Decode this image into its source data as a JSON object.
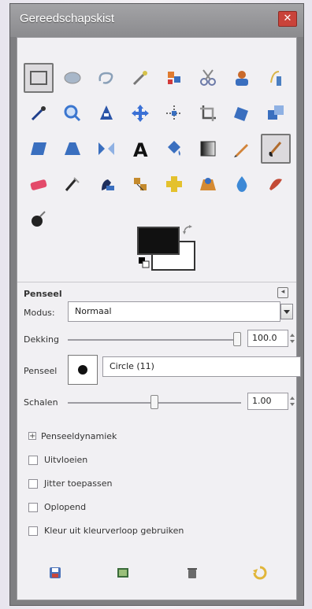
{
  "window": {
    "title": "Gereedschapskist",
    "close_glyph": "✕"
  },
  "tools": [
    {
      "name": "rect-select-icon",
      "kind": "rect",
      "color": "#5c5c5c",
      "active": true
    },
    {
      "name": "ellipse-select-icon",
      "kind": "ellipse",
      "color": "#8aa0b8"
    },
    {
      "name": "lasso-icon",
      "kind": "lasso",
      "color": "#8aa0b8"
    },
    {
      "name": "fuzzy-select-icon",
      "kind": "wand",
      "color": "#d6c24a"
    },
    {
      "name": "select-by-color-icon",
      "kind": "blocks",
      "color": "#e07b2f"
    },
    {
      "name": "scissors-icon",
      "kind": "scissors",
      "color": "#6c7aa8"
    },
    {
      "name": "foreground-select-icon",
      "kind": "person",
      "color": "#c96a2b"
    },
    {
      "name": "paths-icon",
      "kind": "pen",
      "color": "#4b7fc1"
    },
    {
      "name": "color-picker-icon",
      "kind": "picker",
      "color": "#1f3f8c"
    },
    {
      "name": "zoom-icon",
      "kind": "zoom",
      "color": "#3b76cf"
    },
    {
      "name": "measure-icon",
      "kind": "measure",
      "color": "#2b55a8"
    },
    {
      "name": "move-icon",
      "kind": "move",
      "color": "#3a70d5"
    },
    {
      "name": "align-icon",
      "kind": "align",
      "color": "#6a6a6a"
    },
    {
      "name": "crop-icon",
      "kind": "crop",
      "color": "#555"
    },
    {
      "name": "rotate-icon",
      "kind": "rotate",
      "color": "#3a6fbf"
    },
    {
      "name": "scale-icon",
      "kind": "scale",
      "color": "#3a6fbf"
    },
    {
      "name": "shear-icon",
      "kind": "shear",
      "color": "#3a6fbf"
    },
    {
      "name": "perspective-icon",
      "kind": "perspective",
      "color": "#3a6fbf"
    },
    {
      "name": "flip-icon",
      "kind": "flip",
      "color": "#3a6fbf"
    },
    {
      "name": "text-icon",
      "kind": "text",
      "color": "#111"
    },
    {
      "name": "bucket-fill-icon",
      "kind": "bucket",
      "color": "#3a6fbf"
    },
    {
      "name": "gradient-icon",
      "kind": "gradient",
      "color": "#333"
    },
    {
      "name": "pencil-icon",
      "kind": "pencil",
      "color": "#d2843a"
    },
    {
      "name": "paintbrush-icon",
      "kind": "brush",
      "color": "#b06b2d",
      "active": true
    },
    {
      "name": "eraser-icon",
      "kind": "eraser",
      "color": "#e34a6a"
    },
    {
      "name": "airbrush-icon",
      "kind": "airbrush",
      "color": "#2a2a2a"
    },
    {
      "name": "ink-icon",
      "kind": "ink",
      "color": "#1d2e5c"
    },
    {
      "name": "clone-icon",
      "kind": "clone",
      "color": "#c48a2d"
    },
    {
      "name": "heal-icon",
      "kind": "heal",
      "color": "#e4c12d"
    },
    {
      "name": "perspective-clone-icon",
      "kind": "persp-clone",
      "color": "#d58a32"
    },
    {
      "name": "blur-icon",
      "kind": "blur",
      "color": "#3d89d6"
    },
    {
      "name": "smudge-icon",
      "kind": "smudge",
      "color": "#c34a36"
    },
    {
      "name": "dodge-burn-icon",
      "kind": "dodge",
      "color": "#222"
    }
  ],
  "colors": {
    "foreground": "#111111",
    "background": "#ffffff"
  },
  "panel": {
    "title": "Penseel",
    "mode_label": "Modus:",
    "mode_value": "Normaal",
    "opacity_label": "Dekking",
    "opacity_value": "100.0",
    "opacity_level": 1.0,
    "brush_label": "Penseel",
    "brush_name": "Circle (11)",
    "scale_label": "Schalen",
    "scale_value": "1.00",
    "scale_level": 0.5,
    "dynamics_label": "Penseeldynamiek",
    "fade_label": "Uitvloeien",
    "jitter_label": "Jitter toepassen",
    "incremental_label": "Oplopend",
    "gradient_label": "Kleur uit kleurverloop gebruiken"
  },
  "bottom_icons": [
    {
      "name": "save-options-icon",
      "color": "#c9463b"
    },
    {
      "name": "restore-options-icon",
      "color": "#3a6b3a"
    },
    {
      "name": "delete-options-icon",
      "color": "#6a6a6a"
    },
    {
      "name": "reset-options-icon",
      "color": "#e1b63a"
    }
  ]
}
